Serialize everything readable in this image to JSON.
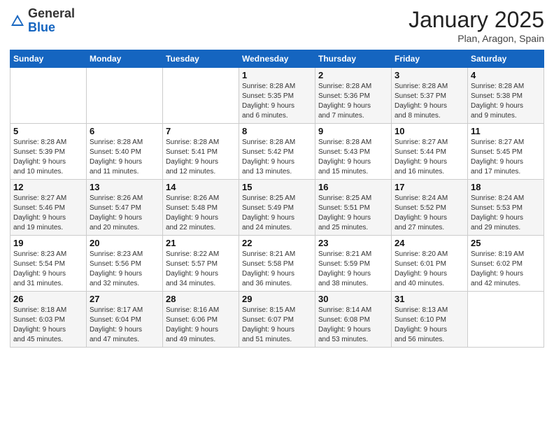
{
  "header": {
    "logo_general": "General",
    "logo_blue": "Blue",
    "title": "January 2025",
    "subtitle": "Plan, Aragon, Spain"
  },
  "days_of_week": [
    "Sunday",
    "Monday",
    "Tuesday",
    "Wednesday",
    "Thursday",
    "Friday",
    "Saturday"
  ],
  "weeks": [
    {
      "days": [
        {
          "num": "",
          "info": ""
        },
        {
          "num": "",
          "info": ""
        },
        {
          "num": "",
          "info": ""
        },
        {
          "num": "1",
          "info": "Sunrise: 8:28 AM\nSunset: 5:35 PM\nDaylight: 9 hours\nand 6 minutes."
        },
        {
          "num": "2",
          "info": "Sunrise: 8:28 AM\nSunset: 5:36 PM\nDaylight: 9 hours\nand 7 minutes."
        },
        {
          "num": "3",
          "info": "Sunrise: 8:28 AM\nSunset: 5:37 PM\nDaylight: 9 hours\nand 8 minutes."
        },
        {
          "num": "4",
          "info": "Sunrise: 8:28 AM\nSunset: 5:38 PM\nDaylight: 9 hours\nand 9 minutes."
        }
      ]
    },
    {
      "days": [
        {
          "num": "5",
          "info": "Sunrise: 8:28 AM\nSunset: 5:39 PM\nDaylight: 9 hours\nand 10 minutes."
        },
        {
          "num": "6",
          "info": "Sunrise: 8:28 AM\nSunset: 5:40 PM\nDaylight: 9 hours\nand 11 minutes."
        },
        {
          "num": "7",
          "info": "Sunrise: 8:28 AM\nSunset: 5:41 PM\nDaylight: 9 hours\nand 12 minutes."
        },
        {
          "num": "8",
          "info": "Sunrise: 8:28 AM\nSunset: 5:42 PM\nDaylight: 9 hours\nand 13 minutes."
        },
        {
          "num": "9",
          "info": "Sunrise: 8:28 AM\nSunset: 5:43 PM\nDaylight: 9 hours\nand 15 minutes."
        },
        {
          "num": "10",
          "info": "Sunrise: 8:27 AM\nSunset: 5:44 PM\nDaylight: 9 hours\nand 16 minutes."
        },
        {
          "num": "11",
          "info": "Sunrise: 8:27 AM\nSunset: 5:45 PM\nDaylight: 9 hours\nand 17 minutes."
        }
      ]
    },
    {
      "days": [
        {
          "num": "12",
          "info": "Sunrise: 8:27 AM\nSunset: 5:46 PM\nDaylight: 9 hours\nand 19 minutes."
        },
        {
          "num": "13",
          "info": "Sunrise: 8:26 AM\nSunset: 5:47 PM\nDaylight: 9 hours\nand 20 minutes."
        },
        {
          "num": "14",
          "info": "Sunrise: 8:26 AM\nSunset: 5:48 PM\nDaylight: 9 hours\nand 22 minutes."
        },
        {
          "num": "15",
          "info": "Sunrise: 8:25 AM\nSunset: 5:49 PM\nDaylight: 9 hours\nand 24 minutes."
        },
        {
          "num": "16",
          "info": "Sunrise: 8:25 AM\nSunset: 5:51 PM\nDaylight: 9 hours\nand 25 minutes."
        },
        {
          "num": "17",
          "info": "Sunrise: 8:24 AM\nSunset: 5:52 PM\nDaylight: 9 hours\nand 27 minutes."
        },
        {
          "num": "18",
          "info": "Sunrise: 8:24 AM\nSunset: 5:53 PM\nDaylight: 9 hours\nand 29 minutes."
        }
      ]
    },
    {
      "days": [
        {
          "num": "19",
          "info": "Sunrise: 8:23 AM\nSunset: 5:54 PM\nDaylight: 9 hours\nand 31 minutes."
        },
        {
          "num": "20",
          "info": "Sunrise: 8:23 AM\nSunset: 5:56 PM\nDaylight: 9 hours\nand 32 minutes."
        },
        {
          "num": "21",
          "info": "Sunrise: 8:22 AM\nSunset: 5:57 PM\nDaylight: 9 hours\nand 34 minutes."
        },
        {
          "num": "22",
          "info": "Sunrise: 8:21 AM\nSunset: 5:58 PM\nDaylight: 9 hours\nand 36 minutes."
        },
        {
          "num": "23",
          "info": "Sunrise: 8:21 AM\nSunset: 5:59 PM\nDaylight: 9 hours\nand 38 minutes."
        },
        {
          "num": "24",
          "info": "Sunrise: 8:20 AM\nSunset: 6:01 PM\nDaylight: 9 hours\nand 40 minutes."
        },
        {
          "num": "25",
          "info": "Sunrise: 8:19 AM\nSunset: 6:02 PM\nDaylight: 9 hours\nand 42 minutes."
        }
      ]
    },
    {
      "days": [
        {
          "num": "26",
          "info": "Sunrise: 8:18 AM\nSunset: 6:03 PM\nDaylight: 9 hours\nand 45 minutes."
        },
        {
          "num": "27",
          "info": "Sunrise: 8:17 AM\nSunset: 6:04 PM\nDaylight: 9 hours\nand 47 minutes."
        },
        {
          "num": "28",
          "info": "Sunrise: 8:16 AM\nSunset: 6:06 PM\nDaylight: 9 hours\nand 49 minutes."
        },
        {
          "num": "29",
          "info": "Sunrise: 8:15 AM\nSunset: 6:07 PM\nDaylight: 9 hours\nand 51 minutes."
        },
        {
          "num": "30",
          "info": "Sunrise: 8:14 AM\nSunset: 6:08 PM\nDaylight: 9 hours\nand 53 minutes."
        },
        {
          "num": "31",
          "info": "Sunrise: 8:13 AM\nSunset: 6:10 PM\nDaylight: 9 hours\nand 56 minutes."
        },
        {
          "num": "",
          "info": ""
        }
      ]
    }
  ]
}
